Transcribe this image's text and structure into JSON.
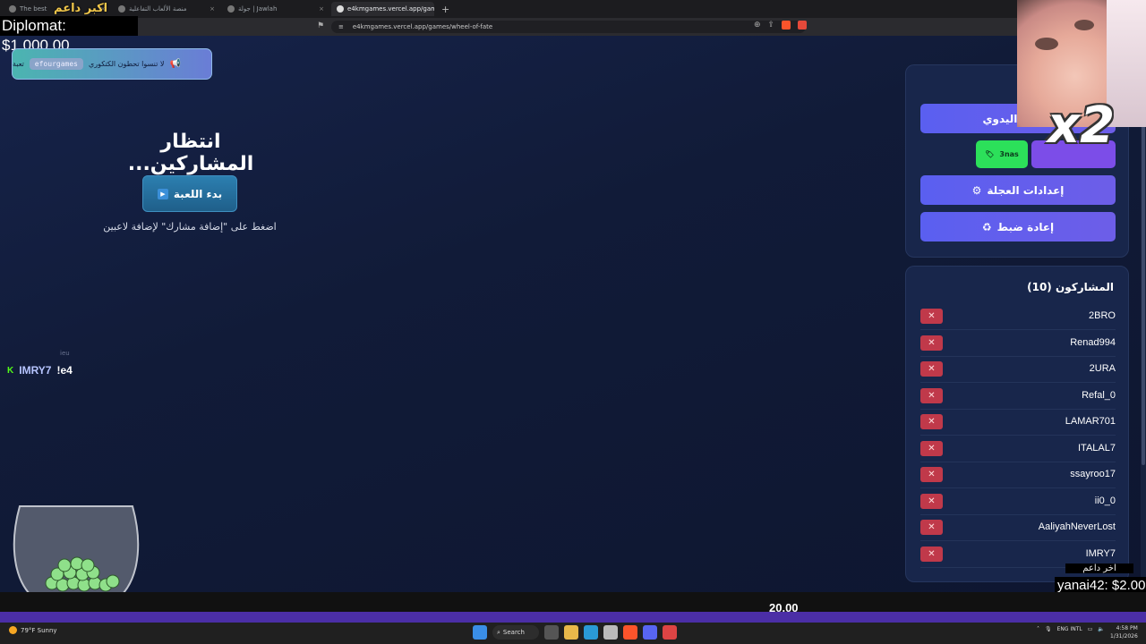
{
  "browser": {
    "tabs": [
      {
        "title": "The best"
      },
      {
        "title": "منصة الألعاب التفاعلية"
      },
      {
        "title": "جولة | Jawlah"
      },
      {
        "title": "e4kmgames.vercel.app/games/w"
      }
    ],
    "new_tab": "+",
    "url": "e4kmgames.vercel.app/games/wheel-of-fate"
  },
  "overlay": {
    "streamer_name": "اكبر داعم",
    "diplomat": "Diplomat: $1,000.00",
    "last_donor_label": "اخر داعم",
    "last_donor": "yanai42: $2.00",
    "goal_amount": "20.00",
    "goal_progress": 0.0,
    "chat_small": "ieu",
    "chat_user": "IMRY7",
    "chat_message": "!e4",
    "chat_platform_icon": "K",
    "x2_label": "x2"
  },
  "toast": {
    "text": "لا تنسوا تحطون الكتكوري",
    "code": "efourgames",
    "suffix": "تعبة"
  },
  "main": {
    "waiting_title": "انتظار المشاركين...",
    "start_button": "بدء اللعبة",
    "hint": "اضغط على \"إضافة مشارك\" لإضافة لاعبين"
  },
  "controls": {
    "manual_mode": "الوضع اليدوي",
    "green_button": "3nas",
    "purple_button": "",
    "wheel_settings": "إعدادات العجلة",
    "reset": "إعادة ضبط"
  },
  "participants": {
    "title": "المشاركون (10)",
    "delete_label": "✕",
    "list": [
      {
        "name": "2BRO"
      },
      {
        "name": "Renad994"
      },
      {
        "name": "2URA"
      },
      {
        "name": "Refal_0"
      },
      {
        "name": "LAMAR701"
      },
      {
        "name": "ITALAL7"
      },
      {
        "name": "ssayroo17"
      },
      {
        "name": "ii0_0"
      },
      {
        "name": "AaliyahNeverLost"
      },
      {
        "name": "IMRY7"
      }
    ]
  },
  "taskbar": {
    "weather": "79°F Sunny",
    "search": "Search",
    "lang": "ENG INTL",
    "time": "4:58 PM",
    "date": "1/31/2026"
  },
  "colors": {
    "accent": "#5a5ff0",
    "delete": "#c0394a",
    "green": "#2ce05a"
  }
}
